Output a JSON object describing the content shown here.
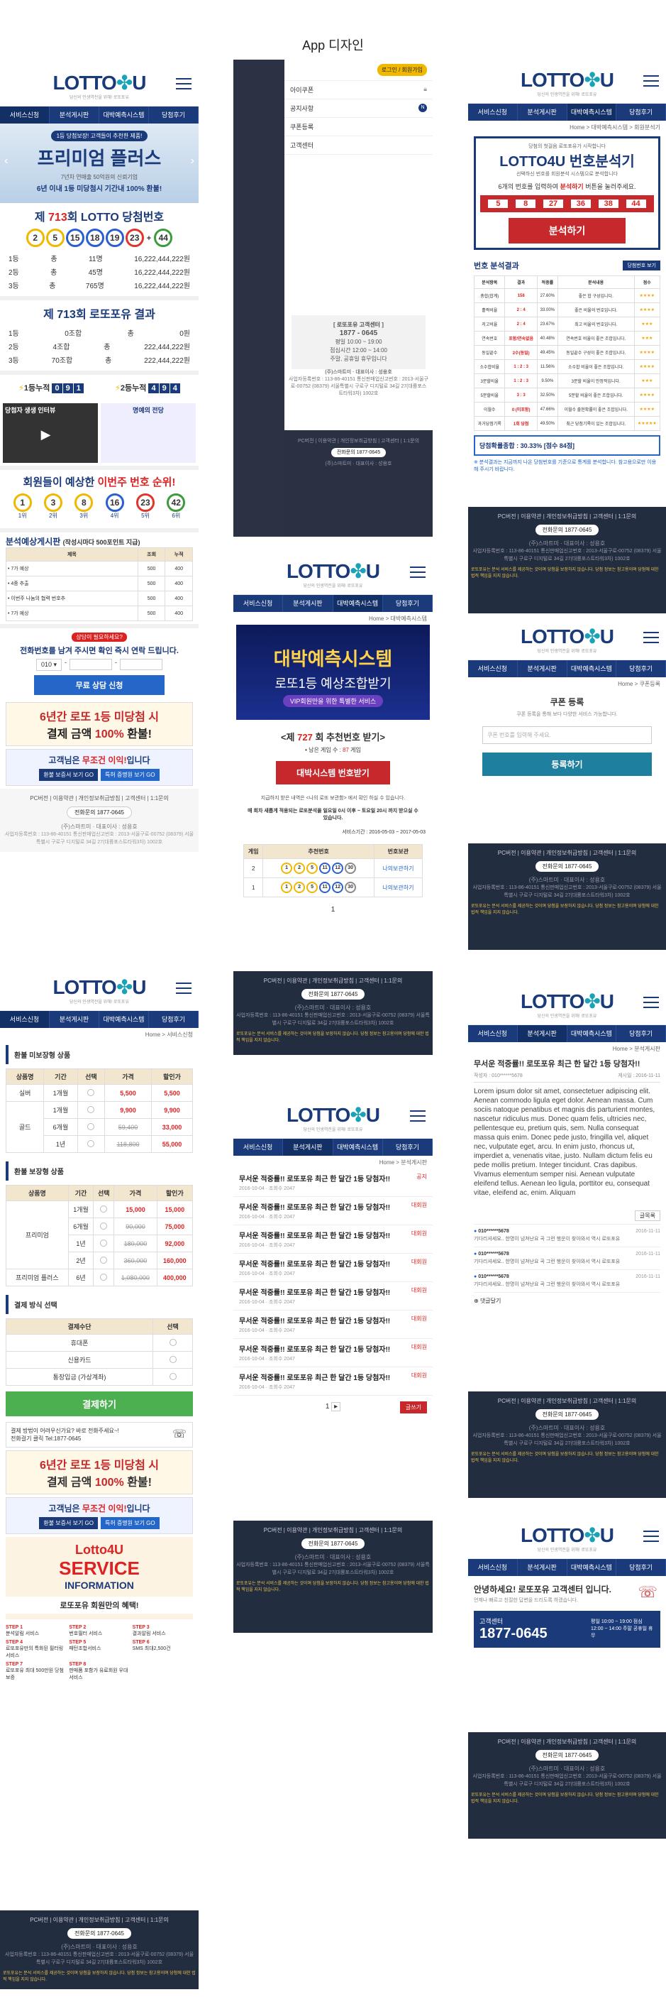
{
  "page_title": "App 디자인",
  "logo": {
    "brand": "LOTTO",
    "brand2": "U",
    "tagline": "당신의 인생역전을 위해! 로또포유"
  },
  "nav": [
    "서비스신청",
    "분석게시판",
    "대박예측시스템",
    "당첨후기"
  ],
  "col1": {
    "hero": {
      "sub": "1등 당첨보장! 고객들이 추천한 제품!",
      "name": "프리미엄 플러스",
      "line1": "7년차 연매출 50억원의 신뢰기업",
      "line2": "6년 이내 1등 미당첨시 기간내 100% 환불!"
    },
    "draw": {
      "title_pre": "제",
      "round": "713",
      "title_post": "회 LOTTO 당첨번호",
      "numbers": [
        "2",
        "5",
        "15",
        "18",
        "19",
        "23"
      ],
      "plus": "+",
      "bonus": "44",
      "rows": [
        [
          "1등",
          "총",
          "11명",
          "16,222,444,222원"
        ],
        [
          "2등",
          "총",
          "45명",
          "16,222,444,222원"
        ],
        [
          "3등",
          "총",
          "765명",
          "16,222,444,222원"
        ]
      ]
    },
    "lf": {
      "title": "제 713회 로또포유 결과",
      "rows": [
        [
          "1등",
          "0조합",
          "총",
          "0원"
        ],
        [
          "2등",
          "4조합",
          "총",
          "222,444,222원"
        ],
        [
          "3등",
          "70조합",
          "총",
          "222,444,222원"
        ]
      ]
    },
    "cum": {
      "l1": "1등누적",
      "v1": [
        "0",
        "9",
        "1"
      ],
      "l2": "2등누적",
      "v2": [
        "4",
        "9",
        "4"
      ]
    },
    "video": {
      "t1": "당첨자 생생 인터뷰",
      "t2": "명예의 전당"
    },
    "predict": {
      "title_a": "회원들이 예상한",
      "title_b": "이번주 번호 순위!",
      "balls": [
        "1",
        "3",
        "8",
        "16",
        "23",
        "42"
      ],
      "ranks": [
        "1위",
        "2위",
        "3위",
        "4위",
        "5위",
        "6위"
      ]
    },
    "board": {
      "title": "분석예상게시판",
      "sub": "(작성시마다 500포인트 지급)",
      "head": [
        "제목",
        "조회",
        "누적"
      ],
      "rows": [
        [
          "• 7가 예상",
          "500",
          "400"
        ],
        [
          "• 4중 추출",
          "500",
          "400"
        ],
        [
          "• 이번주 나눔의 협력 번호추",
          "500",
          "400"
        ],
        [
          "• 7가 예상",
          "500",
          "400"
        ]
      ]
    },
    "consult": {
      "small": "상담이 필요하세요?",
      "title": "전화번호를 남겨 주시면 확인 즉시 연락 드립니다.",
      "prefix": "010",
      "btn": "무료 상담 신청"
    },
    "refund": {
      "t1": "6년간 로또 1등 미당첨 시",
      "t2": "결제 금액",
      "pct": "100%",
      "t3": "환불!"
    },
    "free": {
      "t1": "고객님은",
      "t2": "무조건 이익!",
      "t3": "입니다",
      "b1": "환불 보증서 보기 GO",
      "b2": "특허 증명원 보기 GO"
    },
    "foot": {
      "links": "PC버전 | 이용약관 | 개인정보취급방침 | 고객센터 | 1:1문의",
      "phone": "전화문의 1877-0645",
      "company": "(주)스마트미 · 대표이사 : 성용호",
      "addr": "사업자등록번호 : 113-86-40151 통신판매업신고번호 : 2013-서울구로-00752 (08379) 서울특별시 구로구 디지털로 34길 27(대륭포스트타워3차) 1002호",
      "warn": "로또포유는 분석 서비스를 제공하는 것이며 당첨을 보장하지 않습니다. 당첨 정보는 참고용이며 당첨에 대한 법적 책임을 지지 않습니다."
    }
  },
  "col1b": {
    "crumb": "Home > 서비스신청",
    "t1": "환불 미보장형 상품",
    "h1": [
      "상품명",
      "기간",
      "선택",
      "가격",
      "할인가"
    ],
    "r1": [
      [
        "실버",
        "1개월",
        "",
        "5,500",
        "5,500"
      ],
      [
        "골드",
        "1개월",
        "",
        "9,900",
        "9,900"
      ],
      [
        "",
        "6개월",
        "",
        "59,400",
        "33,000"
      ],
      [
        "",
        "1년",
        "",
        "118,800",
        "55,000"
      ]
    ],
    "t2": "환불 보장형 상품",
    "h2": [
      "상품명",
      "기간",
      "선택",
      "가격",
      "할인가"
    ],
    "r2": [
      [
        "프리미엄",
        "1개월",
        "",
        "15,000",
        "15,000"
      ],
      [
        "",
        "6개월",
        "",
        "90,000",
        "75,000"
      ],
      [
        "",
        "1년",
        "",
        "180,000",
        "92,000"
      ],
      [
        "",
        "2년",
        "",
        "360,000",
        "160,000"
      ],
      [
        "프리미엄 플러스",
        "6년",
        "",
        "1,080,000",
        "400,000"
      ]
    ],
    "t3": "결제 방식 선택",
    "h3": [
      "결제수단",
      "선택"
    ],
    "r3": [
      [
        "휴대폰",
        ""
      ],
      [
        "신용카드",
        ""
      ],
      [
        "통장입금 (가상계좌)",
        ""
      ]
    ],
    "pay": "결제하기",
    "cs": {
      "l1": "결제 방법이 어려우신가요? 바로 전화주세요~!",
      "l2": "전화걸기 클릭 Tel:1877-0645"
    },
    "svc": {
      "a": "Lotto4U",
      "b": "SERVICE",
      "c": "INFORMATION",
      "benefit": "로또포유 회원만의 혜택!"
    },
    "steps": [
      [
        "STEP 1",
        "분석알림 서비스"
      ],
      [
        "STEP 2",
        "번호필터 서비스"
      ],
      [
        "STEP 3",
        "결과알림 서비스"
      ],
      [
        "STEP 4",
        "로또포유만의 특화된 필터링 서비스"
      ],
      [
        "STEP 5",
        "패턴조합서비스"
      ],
      [
        "STEP 6",
        "SMS 최대2,500건"
      ],
      [
        "STEP 7",
        "로또포유 최대 500만원 당첨보증"
      ],
      [
        "STEP 8",
        "판매품 포함가 유료회원 우대 서비스"
      ]
    ]
  },
  "col2": {
    "menu": {
      "login": "로그인 / 회원가입",
      "items": [
        "아이쿠폰",
        "공지사항",
        "쿠폰등록",
        "고객센터"
      ],
      "badge": "N"
    },
    "cs": {
      "t": "[ 로또포유 고객센터 ]",
      "phone": "1877 - 0645",
      "h1": "평일 10:00 ~ 19:00",
      "h2": "점심시간 12:00 ~ 14:00",
      "h3": "주말, 공휴일 휴무입니다"
    },
    "sys": {
      "a": "대박예측시스템",
      "b": "로또1등 예상조합받기",
      "c": "VIP회원만을 위한 특별한 서비스"
    },
    "rec": {
      "pre": "<제",
      "round": "727",
      "post": "회 추천번호 받기>",
      "left": "• 남은 게임 수 :",
      "cnt": "87",
      "unit": "게임",
      "btn": "대박시스템 번호받기",
      "note": "지급하지 받은 내역은 <나의 로또 보관함> 에서 확인 하실 수 있습니다.",
      "note2": "매 회차 새롭게 적용되는 로또분석을 일요일 0시 이후 ~ 토요일 20시 까지 받으실 수 있습니다.",
      "period": "서비스기간 : 2016-05-03 ~ 2017-05-03"
    },
    "rec_tbl": {
      "h": [
        "게임",
        "추천번호",
        "번호보관"
      ],
      "rows": [
        [
          "2",
          [
            "1",
            "2",
            "5",
            "11",
            "12",
            "30"
          ],
          "나의보관하기"
        ],
        [
          "1",
          [
            "1",
            "2",
            "5",
            "11",
            "12",
            "30"
          ],
          "나의보관하기"
        ]
      ]
    },
    "page": "1",
    "crumb2": "Home > 분석게시판",
    "posts": [
      [
        "무서운 적중률!! 로또포유 최근 한 달간 1등 당첨자!!",
        "2016-10-04",
        "조회수 2047",
        "공지"
      ],
      [
        "무서운 적중률!! 로또포유 최근 한 달간 1등 당첨자!!",
        "2016-10-04",
        "조회수 2047",
        "대회원"
      ],
      [
        "무서운 적중률!! 로또포유 최근 한 달간 1등 당첨자!!",
        "2016-10-04",
        "조회수 2047",
        "대회원"
      ],
      [
        "무서운 적중률!! 로또포유 최근 한 달간 1등 당첨자!!",
        "2016-10-04",
        "조회수 2047",
        "대회원"
      ],
      [
        "무서운 적중률!! 로또포유 최근 한 달간 1등 당첨자!!",
        "2016-10-04",
        "조회수 2047",
        "대회원"
      ],
      [
        "무서운 적중률!! 로또포유 최근 한 달간 1등 당첨자!!",
        "2016-10-04",
        "조회수 2047",
        "대회원"
      ],
      [
        "무서운 적중률!! 로또포유 최근 한 달간 1등 당첨자!!",
        "2016-10-04",
        "조회수 2047",
        "대회원"
      ],
      [
        "무서운 적중률!! 로또포유 최근 한 달간 1등 당첨자!!",
        "2016-10-04",
        "조회수 2047",
        "대회원"
      ]
    ],
    "write": "글쓰기"
  },
  "col3": {
    "crumb": "Home > 대박예측시스템 > 회원분석기",
    "an": {
      "s": "당첨의 첫걸음 로또포유가 시작합니다",
      "t": "LOTTO4U 번호분석기",
      "d": "선택하신 번호를 회원분석 시스템으로 분석합니다",
      "q1": "6개의 번호를 입력하여",
      "q2": "분석하기",
      "q3": "버튼을 눌러주세요.",
      "nums": [
        "5",
        "8",
        "27",
        "36",
        "38",
        "44"
      ],
      "btn": "분석하기"
    },
    "res": {
      "t": "번호 분석결과",
      "btn": "당첨번호 보기",
      "h": [
        "분석항목",
        "결과",
        "적중률",
        "분석내용",
        "점수"
      ],
      "rows": [
        [
          "총합(합계)",
          "158",
          "27.60%",
          "좋은 합 구성입니다.",
          "★★★★"
        ],
        [
          "홀짝비율",
          "2 : 4",
          "33.00%",
          "좋은 비율의 번호입니다.",
          "★★★★"
        ],
        [
          "저고비율",
          "2 : 4",
          "23.67%",
          "최고 비율의 번호입니다.",
          "★★★"
        ],
        [
          "연속번호",
          "포함/연속없음",
          "40.48%",
          "연속번호 비율이 좋은 조합입니다.",
          "★★★"
        ],
        [
          "동일끝수",
          "2수(동일)",
          "49.45%",
          "동일끝수 구성이 좋은 조합입니다.",
          "★★★★"
        ],
        [
          "소수합비율",
          "1 : 2 : 3",
          "11.56%",
          "소수합 비율이 좋은 조합입니다.",
          "★★★★"
        ],
        [
          "3분할비율",
          "1 : 2 : 3",
          "9.50%",
          "3분할 비율이 안정적입니다.",
          "★★★"
        ],
        [
          "5분할비율",
          "3 : 3",
          "32.50%",
          "5분할 비율이 좋은 조합입니다.",
          "★★★★"
        ],
        [
          "이월수",
          "0 (미포함)",
          "47.66%",
          "이월수 출현확률이 좋은 조합입니다.",
          "★★★★"
        ],
        [
          "과거당첨기록",
          "1회 당첨",
          "49.50%",
          "최근 당첨기록이 있는 조합입니다.",
          "★★★★★"
        ]
      ],
      "prob": "당첨확률종합 : 30.33% [점수 84점]",
      "note": "※ 분석결과는 지금까지 나온 당첨번호를 기준으로 통계를 분석합니다. 참고용으로만 이용해 주시기 바랍니다."
    },
    "coupon": {
      "crumb": "Home > 쿠폰등록",
      "t": "쿠폰 등록",
      "d": "쿠폰 등록을 통해 보다 다양한 서비스 가능합니다.",
      "ph": "쿠폰 번호를 입력해 주세요.",
      "btn": "등록하기"
    },
    "post": {
      "crumb": "Home > 분석게시판",
      "t": "무서운 적중률!! 로또포유 최근 한 달간 1등 당첨자!!",
      "author": "작성자 : 010******5678",
      "date": "게시일 : 2016-11-11",
      "body": "Lorem ipsum dolor sit amet, consectetuer adipiscing elit. Aenean commodo ligula eget dolor. Aenean massa. Cum sociis natoque penatibus et magnis dis parturient montes, nascetur ridiculus mus. Donec quam felis, ultricies nec, pellentesque eu, pretium quis, sem. Nulla consequat massa quis enim. Donec pede justo, fringilla vel, aliquet nec, vulputate eget, arcu. In enim justo, rhoncus ut, imperdiet a, venenatis vitae, justo. Nullam dictum felis eu pede mollis pretium. Integer tincidunt. Cras dapibus. Vivamus elementum semper nisi. Aenean vulputate eleifend tellus. Aenean leo ligula, porttitor eu, consequat vitae, eleifend ac, enim. Aliquam",
      "list": "글목록",
      "comments": [
        [
          "010******5678",
          "2016-11-11",
          "기다리셔세요.. 한명이 넘쳐난요 곡 그런 행운이 찾아와서 역시 로또포유"
        ],
        [
          "010******5678",
          "2016-11-11",
          "기다리셔세요.. 한명이 넘쳐난요 곡 그런 행운이 찾아와서 역시 로또포유"
        ],
        [
          "010******5678",
          "2016-11-11",
          "기다리셔세요.. 한명이 넘쳐난요 곡 그런 행운이 찾아와서 역시 로또포유"
        ]
      ],
      "cm": "댓글달기"
    },
    "cs": {
      "hi": "안녕하세요! 로또포유 고객센터 입니다.",
      "hi_brand": "로또포유",
      "sub": "언제나 빠르고 친절한 답변을 드리도록 하겠습니다.",
      "label": "고객센터",
      "phone": "1877-0645",
      "hours": "평일 10:00 ~ 19:00 점심 12:00 ~ 14:00 주말 공휴일 휴무"
    }
  }
}
